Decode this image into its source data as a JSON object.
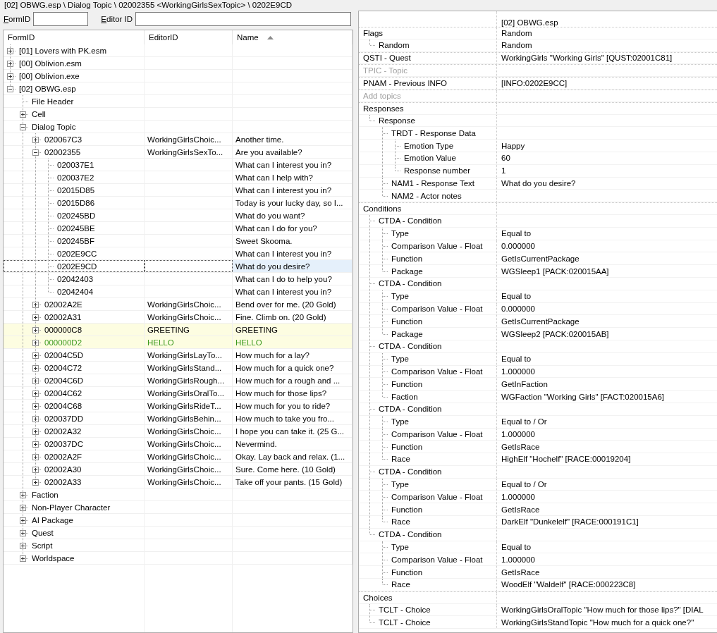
{
  "breadcrumb": "[02] OBWG.esp \\ Dialog Topic \\ 02002355 <WorkingGirlsSexTopic> \\ 0202E9CD",
  "filter": {
    "formid_label": "FormID",
    "editorid_label": "Editor ID"
  },
  "navigator": {
    "columns": [
      {
        "label": "FormID",
        "sorted": false
      },
      {
        "label": "EditorID",
        "sorted": false
      },
      {
        "label": "Name",
        "sorted": true
      }
    ],
    "tree": [
      {
        "form_id": "[01] Lovers with PK.esm",
        "expanded": false,
        "selected": false
      },
      {
        "form_id": "[00] Oblivion.esm",
        "expanded": false,
        "selected": false
      },
      {
        "form_id": "[00] Oblivion.exe",
        "expanded": false,
        "selected": false
      },
      {
        "form_id": "[02] OBWG.esp",
        "expanded": true,
        "selected": false,
        "children": [
          {
            "form_id": "File Header",
            "selected": false
          },
          {
            "form_id": "Cell",
            "expanded": false,
            "selected": false
          },
          {
            "form_id": "Dialog Topic",
            "expanded": true,
            "selected": false,
            "children": [
              {
                "form_id": "020067C3",
                "editor_id": "WorkingGirlsChoic...",
                "name": "Another time.",
                "expanded": false,
                "selected": false,
                "highlighted": false
              },
              {
                "form_id": "02002355",
                "editor_id": "WorkingGirlsSexTo...",
                "name": "Are you available?",
                "expanded": true,
                "selected": false,
                "highlighted": false,
                "children": [
                  {
                    "form_id": "020037E1",
                    "name": "What can I interest you in?",
                    "selected": false
                  },
                  {
                    "form_id": "020037E2",
                    "name": "What can I help with?",
                    "selected": false
                  },
                  {
                    "form_id": "02015D85",
                    "name": "What can I interest you in?",
                    "selected": false
                  },
                  {
                    "form_id": "02015D86",
                    "name": "Today is your lucky day, so I...",
                    "selected": false
                  },
                  {
                    "form_id": "020245BD",
                    "name": "What do you want?",
                    "selected": false
                  },
                  {
                    "form_id": "020245BE",
                    "name": "What can I do for you?",
                    "selected": false
                  },
                  {
                    "form_id": "020245BF",
                    "name": "Sweet Skooma.",
                    "selected": false
                  },
                  {
                    "form_id": "0202E9CC",
                    "name": "What can I interest you in?",
                    "selected": false
                  },
                  {
                    "form_id": "0202E9CD",
                    "name": "What do you desire?",
                    "selected": true
                  },
                  {
                    "form_id": "02042403",
                    "name": "What can I do to help you?",
                    "selected": false
                  },
                  {
                    "form_id": "02042404",
                    "name": "What can I interest you in?",
                    "selected": false
                  }
                ]
              },
              {
                "form_id": "02002A2E",
                "editor_id": "WorkingGirlsChoic...",
                "name": "Bend over for me. (20 Gold)",
                "expanded": false,
                "selected": false,
                "highlighted": false
              },
              {
                "form_id": "02002A31",
                "editor_id": "WorkingGirlsChoic...",
                "name": "Fine. Climb on. (20 Gold)",
                "expanded": false,
                "selected": false,
                "highlighted": false
              },
              {
                "form_id": "000000C8",
                "editor_id": "GREETING",
                "name": "GREETING",
                "expanded": false,
                "selected": false,
                "highlighted": true
              },
              {
                "form_id": "000000D2",
                "editor_id": "HELLO",
                "name": "HELLO",
                "expanded": false,
                "selected": false,
                "highlighted": true,
                "color": "#3c9a1e"
              },
              {
                "form_id": "02004C5D",
                "editor_id": "WorkingGirlsLayTo...",
                "name": "How much for a lay?",
                "expanded": false,
                "selected": false,
                "highlighted": false
              },
              {
                "form_id": "02004C72",
                "editor_id": "WorkingGirlsStand...",
                "name": "How much for a quick one?",
                "expanded": false,
                "selected": false,
                "highlighted": false
              },
              {
                "form_id": "02004C6D",
                "editor_id": "WorkingGirlsRough...",
                "name": "How much for a rough and ...",
                "expanded": false,
                "selected": false,
                "highlighted": false
              },
              {
                "form_id": "02004C62",
                "editor_id": "WorkingGirlsOralTo...",
                "name": "How much for those lips?",
                "expanded": false,
                "selected": false,
                "highlighted": false
              },
              {
                "form_id": "02004C68",
                "editor_id": "WorkingGirlsRideT...",
                "name": "How much for you to ride?",
                "expanded": false,
                "selected": false,
                "highlighted": false
              },
              {
                "form_id": "020037DD",
                "editor_id": "WorkingGirlsBehin...",
                "name": "How much to take you fro...",
                "expanded": false,
                "selected": false,
                "highlighted": false
              },
              {
                "form_id": "02002A32",
                "editor_id": "WorkingGirlsChoic...",
                "name": "I hope you can take it. (25 G...",
                "expanded": false,
                "selected": false,
                "highlighted": false
              },
              {
                "form_id": "020037DC",
                "editor_id": "WorkingGirlsChoic...",
                "name": "Nevermind.",
                "expanded": false,
                "selected": false,
                "highlighted": false
              },
              {
                "form_id": "02002A2F",
                "editor_id": "WorkingGirlsChoic...",
                "name": "Okay. Lay back and relax. (1...",
                "expanded": false,
                "selected": false,
                "highlighted": false
              },
              {
                "form_id": "02002A30",
                "editor_id": "WorkingGirlsChoic...",
                "name": "Sure. Come here. (10 Gold)",
                "expanded": false,
                "selected": false,
                "highlighted": false
              },
              {
                "form_id": "02002A33",
                "editor_id": "WorkingGirlsChoic...",
                "name": "Take off your pants. (15 Gold)",
                "expanded": false,
                "selected": false,
                "highlighted": false
              }
            ]
          },
          {
            "form_id": "Faction",
            "expanded": false,
            "selected": false
          },
          {
            "form_id": "Non-Player Character",
            "expanded": false,
            "selected": false
          },
          {
            "form_id": "AI Package",
            "expanded": false,
            "selected": false
          },
          {
            "form_id": "Quest",
            "expanded": false,
            "selected": false
          },
          {
            "form_id": "Script",
            "expanded": false,
            "selected": false
          },
          {
            "form_id": "Worldspace",
            "expanded": false,
            "selected": false
          }
        ]
      }
    ]
  },
  "record_view": {
    "header": "[02] OBWG.esp",
    "fields": [
      {
        "label": "Flags",
        "value": "Random",
        "disabled": false,
        "children": [
          {
            "label": "Random",
            "value": "Random"
          }
        ]
      },
      {
        "label": "QSTI - Quest",
        "value": "WorkingGirls \"Working Girls\" [QUST:02001C81]",
        "disabled": false
      },
      {
        "label": "TPIC - Topic",
        "disabled": true
      },
      {
        "label": "PNAM - Previous INFO",
        "value": "[INFO:0202E9CC]",
        "disabled": false
      },
      {
        "label": "Add topics",
        "disabled": true
      },
      {
        "label": "Responses",
        "disabled": false,
        "children": [
          {
            "label": "Response",
            "children": [
              {
                "label": "TRDT - Response Data",
                "children": [
                  {
                    "label": "Emotion Type",
                    "value": "Happy"
                  },
                  {
                    "label": "Emotion Value",
                    "value": "60"
                  },
                  {
                    "label": "Response number",
                    "value": "1"
                  }
                ]
              },
              {
                "label": "NAM1 - Response Text",
                "value": "What do you desire?"
              },
              {
                "label": "NAM2 - Actor notes"
              }
            ]
          }
        ]
      },
      {
        "label": "Conditions",
        "disabled": false,
        "children": [
          {
            "label": "CTDA - Condition",
            "children": [
              {
                "label": "Type",
                "value": "Equal to"
              },
              {
                "label": "Comparison Value - Float",
                "value": "0.000000"
              },
              {
                "label": "Function",
                "value": "GetIsCurrentPackage"
              },
              {
                "label": "Package",
                "value": "WGSleep1 [PACK:020015AA]"
              }
            ]
          },
          {
            "label": "CTDA - Condition",
            "children": [
              {
                "label": "Type",
                "value": "Equal to"
              },
              {
                "label": "Comparison Value - Float",
                "value": "0.000000"
              },
              {
                "label": "Function",
                "value": "GetIsCurrentPackage"
              },
              {
                "label": "Package",
                "value": "WGSleep2 [PACK:020015AB]"
              }
            ]
          },
          {
            "label": "CTDA - Condition",
            "children": [
              {
                "label": "Type",
                "value": "Equal to"
              },
              {
                "label": "Comparison Value - Float",
                "value": "1.000000"
              },
              {
                "label": "Function",
                "value": "GetInFaction"
              },
              {
                "label": "Faction",
                "value": "WGFaction \"Working Girls\" [FACT:020015A6]"
              }
            ]
          },
          {
            "label": "CTDA - Condition",
            "children": [
              {
                "label": "Type",
                "value": "Equal to / Or"
              },
              {
                "label": "Comparison Value - Float",
                "value": "1.000000"
              },
              {
                "label": "Function",
                "value": "GetIsRace"
              },
              {
                "label": "Race",
                "value": "HighElf \"Hochelf\" [RACE:00019204]"
              }
            ]
          },
          {
            "label": "CTDA - Condition",
            "children": [
              {
                "label": "Type",
                "value": "Equal to / Or"
              },
              {
                "label": "Comparison Value - Float",
                "value": "1.000000"
              },
              {
                "label": "Function",
                "value": "GetIsRace"
              },
              {
                "label": "Race",
                "value": "DarkElf \"Dunkelelf\" [RACE:000191C1]"
              }
            ]
          },
          {
            "label": "CTDA - Condition",
            "children": [
              {
                "label": "Type",
                "value": "Equal to"
              },
              {
                "label": "Comparison Value - Float",
                "value": "1.000000"
              },
              {
                "label": "Function",
                "value": "GetIsRace"
              },
              {
                "label": "Race",
                "value": "WoodElf \"Waldelf\" [RACE:000223C8]"
              }
            ]
          }
        ]
      },
      {
        "label": "Choices",
        "disabled": false,
        "children": [
          {
            "label": "TCLT - Choice",
            "value": "WorkingGirlsOralTopic \"How much for those lips?\" [DIAL"
          },
          {
            "label": "TCLT - Choice",
            "value": "WorkingGirlsStandTopic \"How much for a quick one?\""
          }
        ]
      }
    ]
  }
}
